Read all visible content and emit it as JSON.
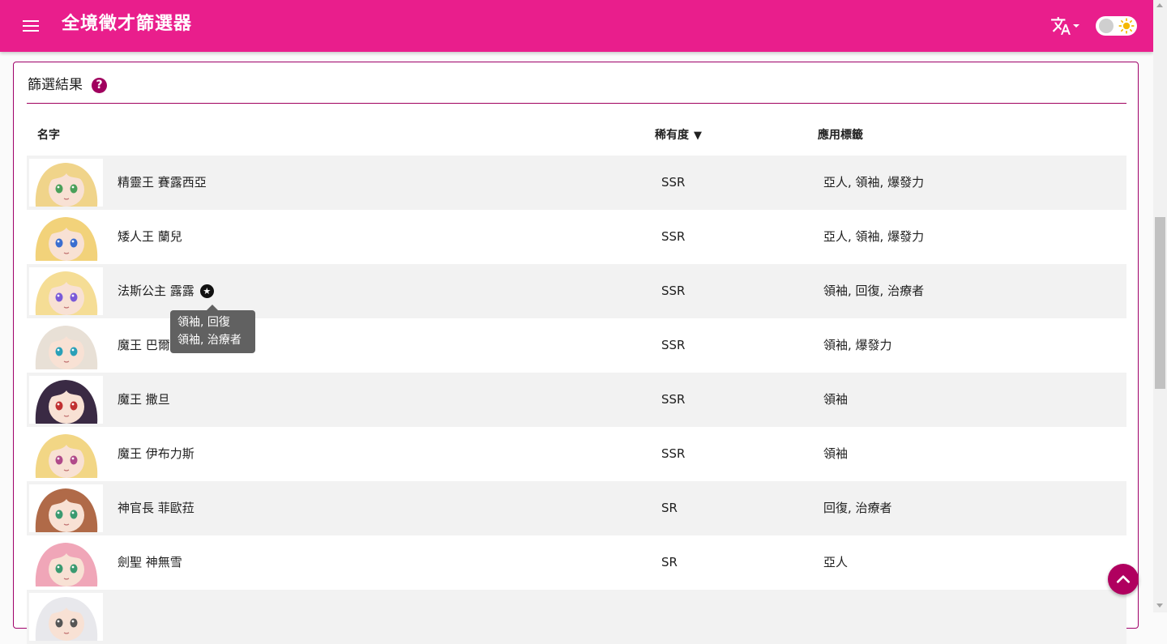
{
  "app": {
    "title": "全境徵才篩選器",
    "accent_color": "#e91e8c",
    "menu_icon": "menu-icon",
    "language_icon": "translate-icon",
    "theme_icon": "sun-icon"
  },
  "results": {
    "title": "篩選結果",
    "help_label": "?",
    "columns": {
      "name": "名字",
      "rarity": "稀有度",
      "rarity_sort": "▼",
      "tags": "應用標籤"
    },
    "rows": [
      {
        "name": "精靈王 賽露西亞",
        "rarity": "SSR",
        "tags": "亞人, 領袖, 爆發力",
        "avatar_hair": "#f0d48a",
        "avatar_eyes": "#4aa05a"
      },
      {
        "name": "矮人王 蘭兒",
        "rarity": "SSR",
        "tags": "亞人, 領袖, 爆發力",
        "avatar_hair": "#f2d27a",
        "avatar_eyes": "#3a6ed0"
      },
      {
        "name": "法斯公主 露露",
        "rarity": "SSR",
        "tags": "領袖, 回復, 治療者",
        "avatar_hair": "#f5dd95",
        "avatar_eyes": "#7a5ad8",
        "badge": "★"
      },
      {
        "name": "魔王 巴爾",
        "rarity": "SSR",
        "tags": "領袖, 爆發力",
        "avatar_hair": "#e8e0d6",
        "avatar_eyes": "#2aa0b8"
      },
      {
        "name": "魔王 撒旦",
        "rarity": "SSR",
        "tags": "領袖",
        "avatar_hair": "#3a2a44",
        "avatar_eyes": "#c03030"
      },
      {
        "name": "魔王 伊布力斯",
        "rarity": "SSR",
        "tags": "領袖",
        "avatar_hair": "#f2d685",
        "avatar_eyes": "#b04a8a"
      },
      {
        "name": "神官長 菲歐菈",
        "rarity": "SR",
        "tags": "回復, 治療者",
        "avatar_hair": "#b06a48",
        "avatar_eyes": "#3a9a70"
      },
      {
        "name": "劍聖 神無雪",
        "rarity": "SR",
        "tags": "亞人",
        "avatar_hair": "#f0a6b8",
        "avatar_eyes": "#3a9a70"
      },
      {
        "name": "",
        "rarity": "",
        "tags": "",
        "avatar_hair": "#e8e8ec",
        "avatar_eyes": "#555555"
      }
    ]
  },
  "tooltip": {
    "line1": "領袖, 回復",
    "line2": "領袖, 治療者"
  },
  "fab": {
    "icon": "chevron-up-icon"
  }
}
